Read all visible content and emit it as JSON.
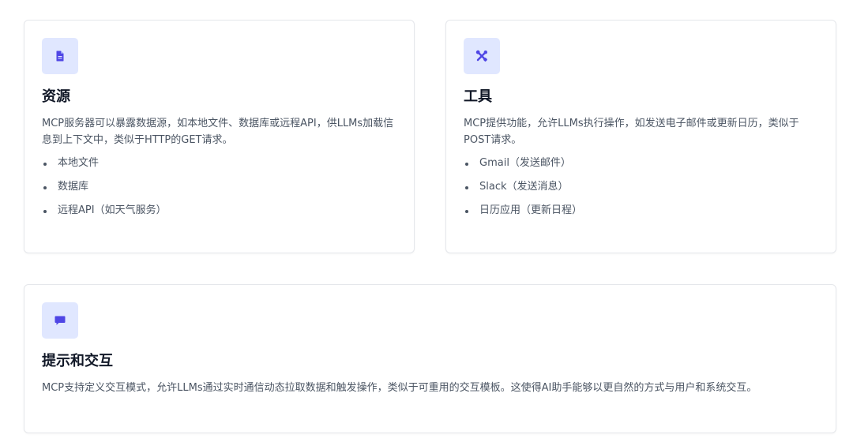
{
  "accent_color": "#4f46e5",
  "icon_bg_color": "#e0e7ff",
  "cards": [
    {
      "icon": "document-icon",
      "title": "资源",
      "description": "MCP服务器可以暴露数据源，如本地文件、数据库或远程API，供LLMs加载信息到上下文中，类似于HTTP的GET请求。",
      "items": [
        "本地文件",
        "数据库",
        "远程API（如天气服务）"
      ]
    },
    {
      "icon": "tools-icon",
      "title": "工具",
      "description": "MCP提供功能，允许LLMs执行操作，如发送电子邮件或更新日历，类似于POST请求。",
      "items": [
        "Gmail（发送邮件）",
        "Slack（发送消息）",
        "日历应用（更新日程）"
      ]
    },
    {
      "icon": "chat-bubble-icon",
      "title": "提示和交互",
      "description": "MCP支持定义交互模式，允许LLMs通过实时通信动态拉取数据和触发操作，类似于可重用的交互模板。这使得AI助手能够以更自然的方式与用户和系统交互。"
    }
  ]
}
